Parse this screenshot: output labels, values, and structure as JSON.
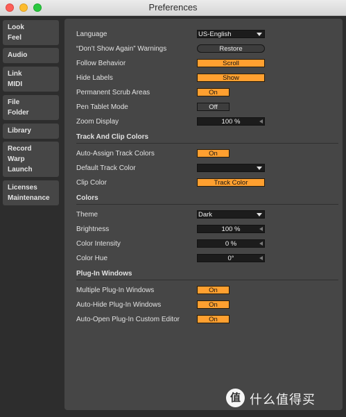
{
  "window": {
    "title": "Preferences"
  },
  "sidebar": {
    "tabs": [
      {
        "lines": [
          "Look",
          "Feel"
        ]
      },
      {
        "lines": [
          "Audio"
        ]
      },
      {
        "lines": [
          "Link",
          "MIDI"
        ]
      },
      {
        "lines": [
          "File",
          "Folder"
        ]
      },
      {
        "lines": [
          "Library"
        ]
      },
      {
        "lines": [
          "Record",
          "Warp",
          "Launch"
        ]
      },
      {
        "lines": [
          "Licenses",
          "Maintenance"
        ]
      }
    ]
  },
  "settings": {
    "language": {
      "label": "Language",
      "value": "US-English"
    },
    "dont_show": {
      "label": "“Don’t Show Again” Warnings",
      "value": "Restore"
    },
    "follow": {
      "label": "Follow Behavior",
      "value": "Scroll"
    },
    "hide_labels": {
      "label": "Hide Labels",
      "value": "Show"
    },
    "scrub": {
      "label": "Permanent Scrub Areas",
      "value": "On"
    },
    "pen": {
      "label": "Pen Tablet Mode",
      "value": "Off"
    },
    "zoom": {
      "label": "Zoom Display",
      "value": "100 %"
    }
  },
  "track_colors": {
    "heading": "Track And Clip Colors",
    "auto_assign": {
      "label": "Auto-Assign Track Colors",
      "value": "On"
    },
    "default_color": {
      "label": "Default Track Color",
      "value": ""
    },
    "clip_color": {
      "label": "Clip Color",
      "value": "Track Color"
    }
  },
  "colors": {
    "heading": "Colors",
    "theme": {
      "label": "Theme",
      "value": "Dark"
    },
    "brightness": {
      "label": "Brightness",
      "value": "100 %"
    },
    "intensity": {
      "label": "Color Intensity",
      "value": "0 %"
    },
    "hue": {
      "label": "Color Hue",
      "value": "0°"
    }
  },
  "plugins": {
    "heading": "Plug-In Windows",
    "multiple": {
      "label": "Multiple Plug-In Windows",
      "value": "On"
    },
    "auto_hide": {
      "label": "Auto-Hide Plug-In Windows",
      "value": "On"
    },
    "auto_open": {
      "label": "Auto-Open Plug-In Custom Editor",
      "value": "On"
    }
  },
  "watermark": {
    "logo": "值",
    "text": "什么值得买"
  },
  "theme_colors": {
    "accent": "#ffa030",
    "panel": "#464646",
    "background": "#2d2d2d"
  }
}
